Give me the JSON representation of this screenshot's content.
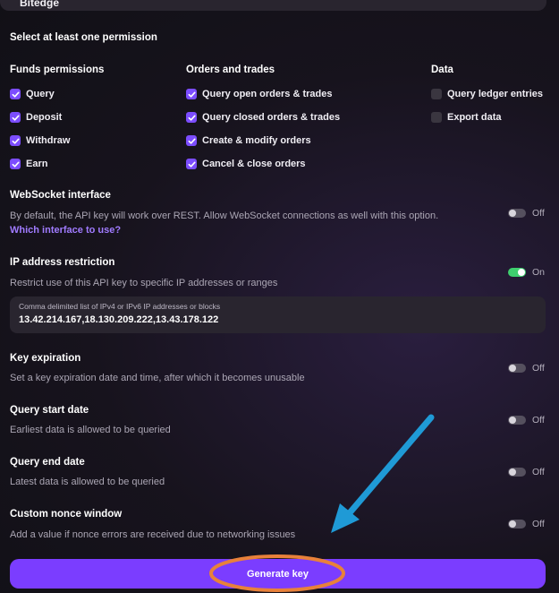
{
  "top_field": {
    "value": "Bitedge"
  },
  "permissions": {
    "instruction": "Select at least one permission",
    "columns": [
      {
        "title": "Funds permissions",
        "items": [
          {
            "label": "Query",
            "checked": true
          },
          {
            "label": "Deposit",
            "checked": true
          },
          {
            "label": "Withdraw",
            "checked": true
          },
          {
            "label": "Earn",
            "checked": true
          }
        ]
      },
      {
        "title": "Orders and trades",
        "items": [
          {
            "label": "Query open orders & trades",
            "checked": true
          },
          {
            "label": "Query closed orders & trades",
            "checked": true
          },
          {
            "label": "Create & modify orders",
            "checked": true
          },
          {
            "label": "Cancel & close orders",
            "checked": true
          }
        ]
      },
      {
        "title": "Data",
        "items": [
          {
            "label": "Query ledger entries",
            "checked": false
          },
          {
            "label": "Export data",
            "checked": false
          }
        ]
      }
    ]
  },
  "websocket": {
    "title": "WebSocket interface",
    "description": "By default, the API key will work over REST. Allow WebSocket connections as well with this option.",
    "link": "Which interface to use?",
    "toggle": "Off"
  },
  "ip": {
    "title": "IP address restriction",
    "description": "Restrict use of this API key to specific IP addresses or ranges",
    "toggle": "On",
    "input_caption": "Comma delimited list of IPv4 or IPv6 IP addresses or blocks",
    "input_value": "13.42.214.167,18.130.209.222,13.43.178.122"
  },
  "expiration": {
    "title": "Key expiration",
    "description": "Set a key expiration date and time, after which it becomes unusable",
    "toggle": "Off"
  },
  "start_date": {
    "title": "Query start date",
    "description": "Earliest data is allowed to be queried",
    "toggle": "Off"
  },
  "end_date": {
    "title": "Query end date",
    "description": "Latest data is allowed to be queried",
    "toggle": "Off"
  },
  "nonce": {
    "title": "Custom nonce window",
    "description": "Add a value if nonce errors are received due to networking issues",
    "toggle": "Off"
  },
  "generate_button": "Generate key",
  "colors": {
    "accent": "#7b3dff",
    "toggle_on": "#3ecf6e",
    "annotation_arrow": "#1f9ad6",
    "annotation_ring": "#e8813a"
  }
}
